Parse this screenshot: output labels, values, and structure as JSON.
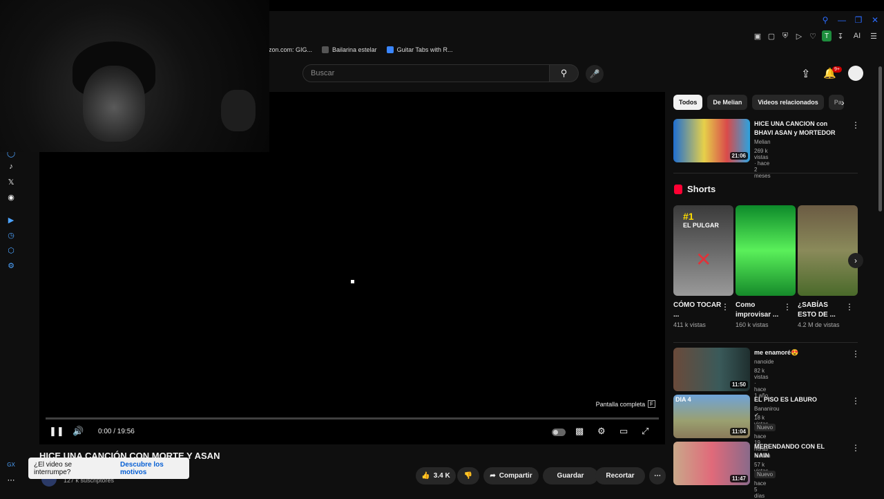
{
  "browser": {
    "bookmarks": [
      "azon.com: GIG...",
      "Bailarina estelar",
      "Guitar Tabs with R..."
    ],
    "window_controls": [
      "search-icon",
      "minimize-icon",
      "restore-icon",
      "close-icon"
    ],
    "ext_profile_letter": "T",
    "ai_label": "AI"
  },
  "header": {
    "search_placeholder": "Buscar",
    "notification_count": "9+"
  },
  "player": {
    "fullscreen_tip": "Pantalla completa",
    "fullscreen_key": "F",
    "time": "0:00 / 19:56"
  },
  "video": {
    "title": "HICE UNA CANCIÓN CON MORTE Y ASAN",
    "subscribers": "127 k suscriptores",
    "likes": "3.4 K",
    "share_label": "Compartir",
    "save_label": "Guardar",
    "clip_label": "Recortar"
  },
  "toast": {
    "question": "¿El video se interrumpe?",
    "link": "Descubre los motivos"
  },
  "chips": [
    "Todos",
    "De Melian",
    "Videos relacionados",
    "Pa"
  ],
  "shorts": {
    "heading": "Shorts",
    "items": [
      {
        "title": "CÓMO TOCAR ...",
        "views": "411 k vistas",
        "overlay": "#1",
        "overlay2": "EL PULGAR"
      },
      {
        "title": "Como improvisar ...",
        "views": "160 k vistas"
      },
      {
        "title": "¿SABÍAS ESTO DE ...",
        "views": "4.2 M de vistas"
      }
    ]
  },
  "recommendations": [
    {
      "title": "HICE UNA CANCION con BHAVI ASAN y MORTEDOR",
      "channel": "Melian",
      "meta": "269 k vistas · hace 2 meses",
      "duration": "21:06"
    },
    {
      "title": "me enamoré😍",
      "channel": "nanoide",
      "meta": "82 k vistas · hace 1 año",
      "duration": "11:50"
    },
    {
      "title": "EL PISO ES LABURO",
      "channel": "Bananirou",
      "meta": "18 k vistas · hace 19 horas",
      "duration": "11:04",
      "badge": "Nuevo",
      "thumb_label": "DIA 4"
    },
    {
      "title": "MERENDANDO CON EL NAIN",
      "channel": "Melian",
      "meta": "57 k vistas · hace 5 días",
      "duration": "11:47",
      "badge": "Nuevo"
    }
  ],
  "sidebar": {
    "bottom_label": "GX"
  }
}
